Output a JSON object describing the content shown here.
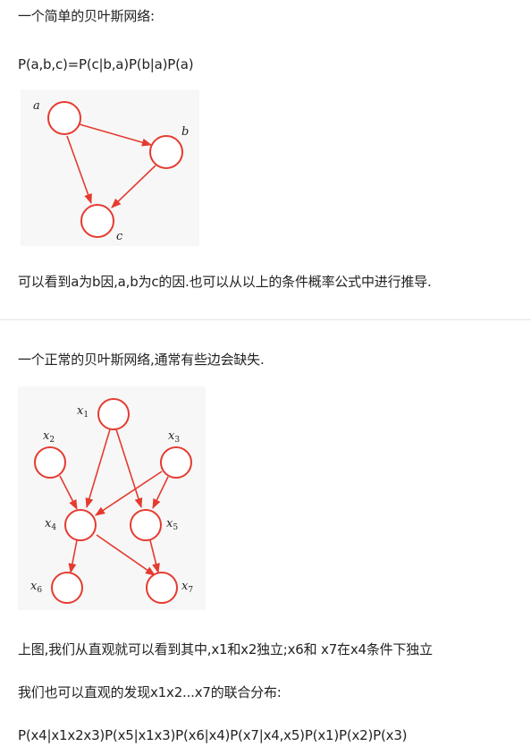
{
  "section1": {
    "intro": "一个简单的贝叶斯网络:",
    "formula": "P(a,b,c)=P(c|b,a)P(b|a)P(a)",
    "caption": "可以看到a为b因,a,b为c的因.也可以从以上的条件概率公式中进行推导."
  },
  "diagram1": {
    "nodes": [
      {
        "id": "a",
        "label": "a"
      },
      {
        "id": "b",
        "label": "b"
      },
      {
        "id": "c",
        "label": "c"
      }
    ],
    "edges": [
      {
        "from": "a",
        "to": "b"
      },
      {
        "from": "a",
        "to": "c"
      },
      {
        "from": "b",
        "to": "c"
      }
    ],
    "edge_color": "#e53b30"
  },
  "section2": {
    "intro": "一个正常的贝叶斯网络,通常有些边会缺失.",
    "line1": "上图,我们从直观就可以看到其中,x1和x2独立;x6和 x7在x4条件下独立",
    "line2": "我们也可以直观的发现x1x2...x7的联合分布:",
    "formula": "P(x4|x1x2x3)P(x5|x1x3)P(x6|x4)P(x7|x4,x5)P(x1)P(x2)P(x3)"
  },
  "diagram2": {
    "nodes": [
      {
        "id": "x1",
        "base": "x",
        "sub": "1"
      },
      {
        "id": "x2",
        "base": "x",
        "sub": "2"
      },
      {
        "id": "x3",
        "base": "x",
        "sub": "3"
      },
      {
        "id": "x4",
        "base": "x",
        "sub": "4"
      },
      {
        "id": "x5",
        "base": "x",
        "sub": "5"
      },
      {
        "id": "x6",
        "base": "x",
        "sub": "6"
      },
      {
        "id": "x7",
        "base": "x",
        "sub": "7"
      }
    ],
    "edges": [
      {
        "from": "x1",
        "to": "x4"
      },
      {
        "from": "x1",
        "to": "x5"
      },
      {
        "from": "x2",
        "to": "x4"
      },
      {
        "from": "x3",
        "to": "x4"
      },
      {
        "from": "x3",
        "to": "x5"
      },
      {
        "from": "x4",
        "to": "x6"
      },
      {
        "from": "x4",
        "to": "x7"
      },
      {
        "from": "x5",
        "to": "x7"
      }
    ],
    "edge_color": "#e53b30"
  }
}
